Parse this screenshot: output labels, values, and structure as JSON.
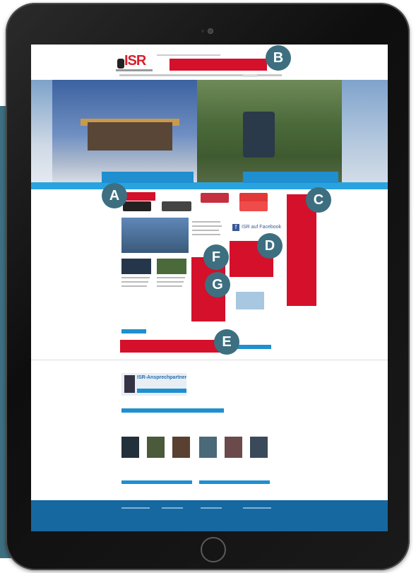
{
  "site": {
    "logo_text": "ISR",
    "facebook_label": "ISR auf Facebook",
    "person_name": "ISR-Ansprechpartner"
  },
  "callouts": {
    "a": "A",
    "b": "B",
    "c": "C",
    "d": "D",
    "e": "E",
    "f": "F",
    "g": "G"
  },
  "colors": {
    "brand_red": "#d91f2b",
    "highlight_red": "#d4102a",
    "callout_badge": "#3d6f80",
    "accent_blue": "#1f8fd0",
    "footer_blue": "#1668a0"
  }
}
